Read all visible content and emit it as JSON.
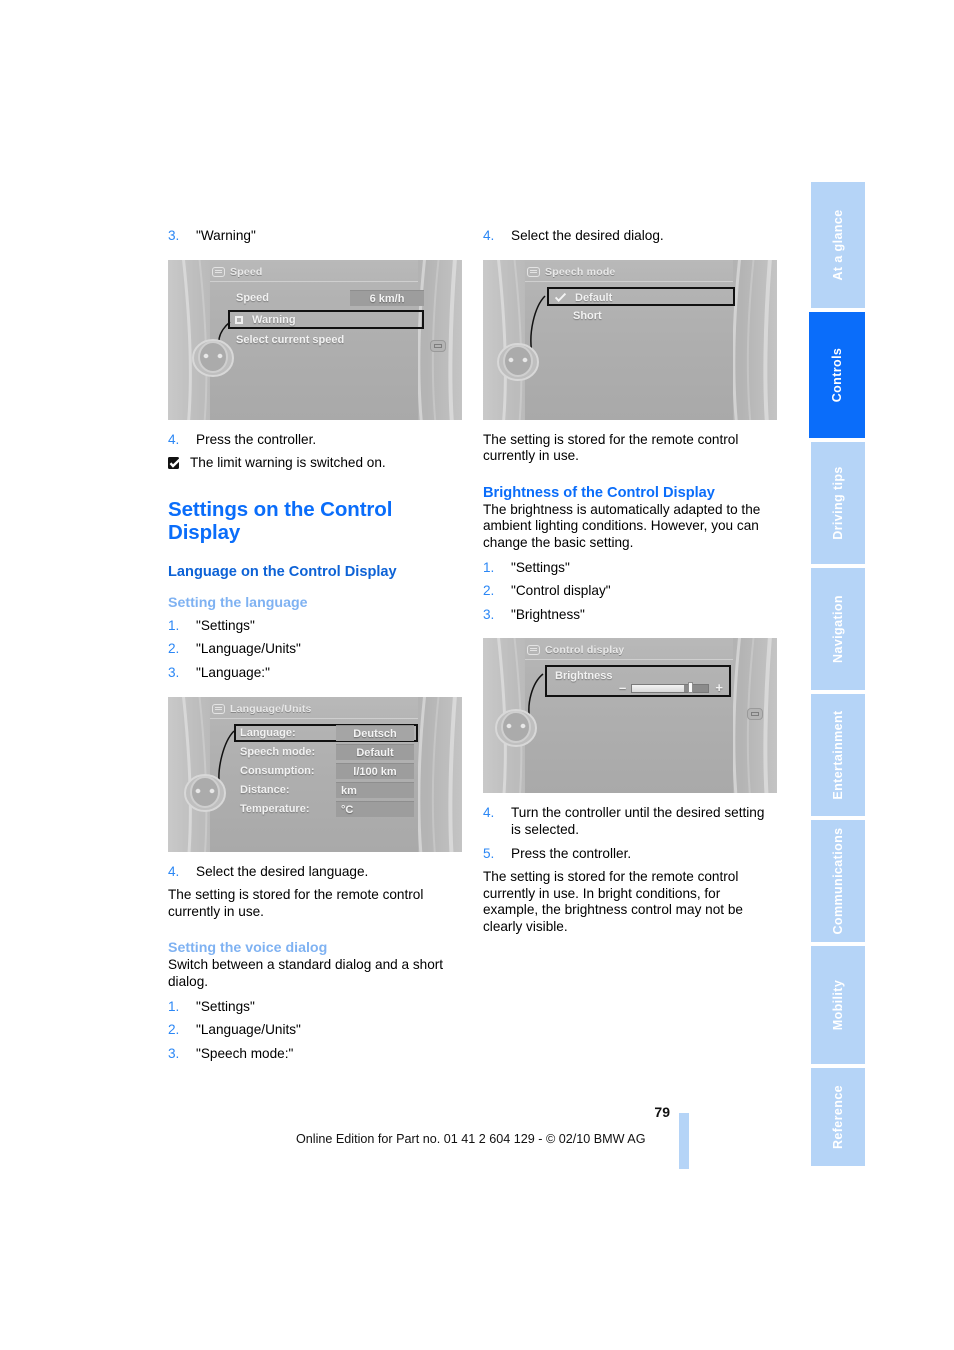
{
  "page": {
    "number": "79",
    "edition_notice": "Online Edition for Part no. 01 41 2 604 129 - © 02/10 BMW AG",
    "accent_blue": "#0a6dfa",
    "tab_blue": "#b5d4f7",
    "step_number_blue": "#2b87f5",
    "minor_heading_blue": "#7fb2f2"
  },
  "sidebar": {
    "tabs": [
      {
        "label": "At a glance",
        "active": false
      },
      {
        "label": "Controls",
        "active": true
      },
      {
        "label": "Driving tips",
        "active": false
      },
      {
        "label": "Navigation",
        "active": false
      },
      {
        "label": "Entertainment",
        "active": false
      },
      {
        "label": "Communications",
        "active": false
      },
      {
        "label": "Mobility",
        "active": false
      },
      {
        "label": "Reference",
        "active": false
      }
    ]
  },
  "left_column": {
    "step3": {
      "num": "3.",
      "text": "\"Warning\""
    },
    "speed_screen": {
      "title": "Speed",
      "row_label": "Speed",
      "row_value": "6 km/h",
      "selected_item": "Warning",
      "hint": "Select current speed"
    },
    "step4": {
      "num": "4.",
      "text": "Press the controller."
    },
    "note": "The limit warning is switched on.",
    "heading_main": "Settings on the Control Display",
    "heading_language": "Language on the Control Display",
    "heading_setting_language": "Setting the language",
    "lang_steps": [
      {
        "num": "1.",
        "text": "\"Settings\""
      },
      {
        "num": "2.",
        "text": "\"Language/Units\""
      },
      {
        "num": "3.",
        "text": "\"Language:\""
      }
    ],
    "language_screen": {
      "title": "Language/Units",
      "rows": [
        {
          "label": "Language:",
          "value": "Deutsch",
          "selected": true
        },
        {
          "label": "Speech mode:",
          "value": "Default",
          "selected": false
        },
        {
          "label": "Consumption:",
          "value": "l/100 km",
          "selected": false
        },
        {
          "label": "Distance:",
          "value": "km",
          "selected": false
        },
        {
          "label": "Temperature:",
          "value": "°C",
          "selected": false
        }
      ]
    },
    "step4b": {
      "num": "4.",
      "text": "Select the desired language."
    },
    "stored_text": "The setting is stored for the remote control currently in use.",
    "heading_voice_dialog": "Setting the voice dialog",
    "voice_intro": "Switch between a standard dialog and a short dialog.",
    "voice_steps": [
      {
        "num": "1.",
        "text": "\"Settings\""
      },
      {
        "num": "2.",
        "text": "\"Language/Units\""
      },
      {
        "num": "3.",
        "text": "\"Speech mode:\""
      }
    ]
  },
  "right_column": {
    "step4": {
      "num": "4.",
      "text": "Select the desired dialog."
    },
    "speech_screen": {
      "title": "Speech mode",
      "items": [
        {
          "label": "Default",
          "checked": true,
          "selected": true
        },
        {
          "label": "Short",
          "checked": false,
          "selected": false
        }
      ]
    },
    "stored_text": "The setting is stored for the remote control currently in use.",
    "heading_brightness": "Brightness of the Control Display",
    "brightness_intro": "The brightness is automatically adapted to the ambient lighting conditions. However, you can change the basic setting.",
    "brightness_steps": [
      {
        "num": "1.",
        "text": "\"Settings\""
      },
      {
        "num": "2.",
        "text": "\"Control display\""
      },
      {
        "num": "3.",
        "text": "\"Brightness\""
      }
    ],
    "control_display_screen": {
      "title": "Control display",
      "row_label": "Brightness",
      "slider_minus": "–",
      "slider_plus": "+",
      "slider_percent": 68
    },
    "step4b": {
      "num": "4.",
      "text": "Turn the controller until the desired setting is selected."
    },
    "step5": {
      "num": "5.",
      "text": "Press the controller."
    },
    "closing_text": "The setting is stored for the remote control currently in use. In bright conditions, for example, the brightness control may not be clearly visible."
  }
}
